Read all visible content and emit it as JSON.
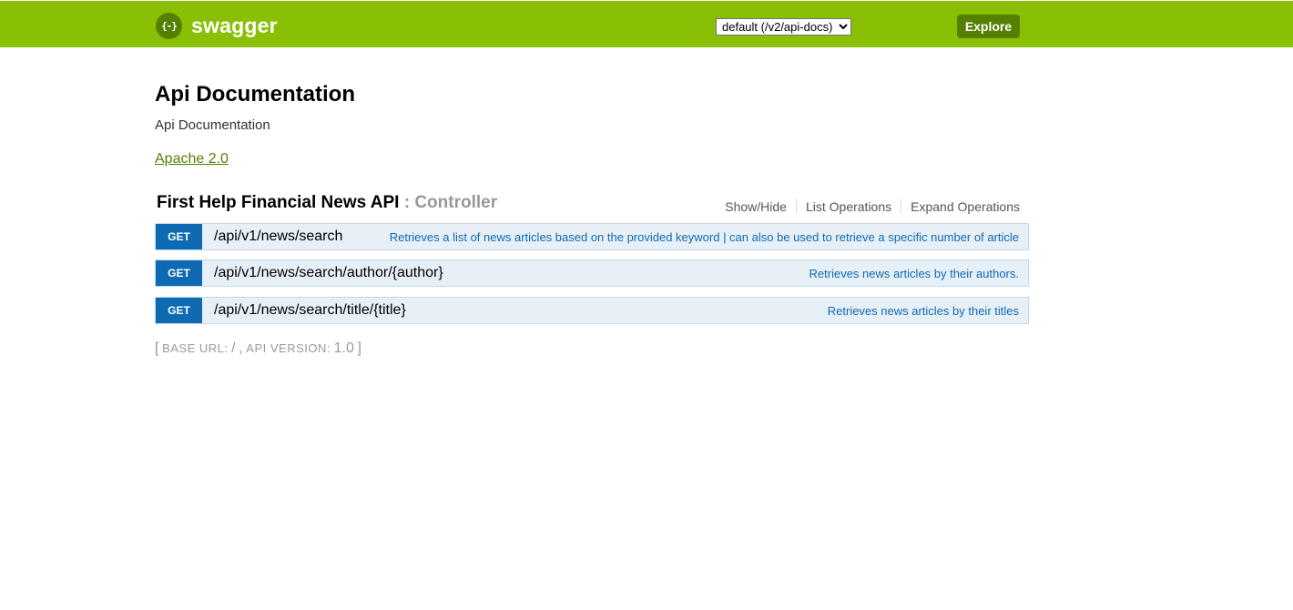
{
  "header": {
    "logo_icon_text": "{-}",
    "logo_text": "swagger",
    "spec_selected": "default (/v2/api-docs)",
    "explore_label": "Explore",
    "brand_color": "#89bf04",
    "dark_green": "#547f00"
  },
  "info": {
    "title": "Api Documentation",
    "description": "Api Documentation",
    "license": "Apache 2.0"
  },
  "resource": {
    "name": "First Help Financial News API",
    "separator": ":",
    "type": "Controller",
    "options": [
      "Show/Hide",
      "List Operations",
      "Expand Operations"
    ]
  },
  "operations": [
    {
      "method": "GET",
      "path": "/api/v1/news/search",
      "summary": "Retrieves a list of news articles based on the provided keyword | can also be used to retrieve a specific number of article"
    },
    {
      "method": "GET",
      "path": "/api/v1/news/search/author/{author}",
      "summary": "Retrieves news articles by their authors."
    },
    {
      "method": "GET",
      "path": "/api/v1/news/search/title/{title}",
      "summary": "Retrieves news articles by their titles"
    }
  ],
  "footer": {
    "open_bracket": "[",
    "base_url_label": "BASE URL:",
    "base_url": "/",
    "comma": ",",
    "api_version_label": "API VERSION:",
    "api_version": "1.0",
    "close_bracket": "]"
  },
  "colors": {
    "get_method": "#0f6ab4",
    "get_row_bg": "#e7f0f7"
  }
}
